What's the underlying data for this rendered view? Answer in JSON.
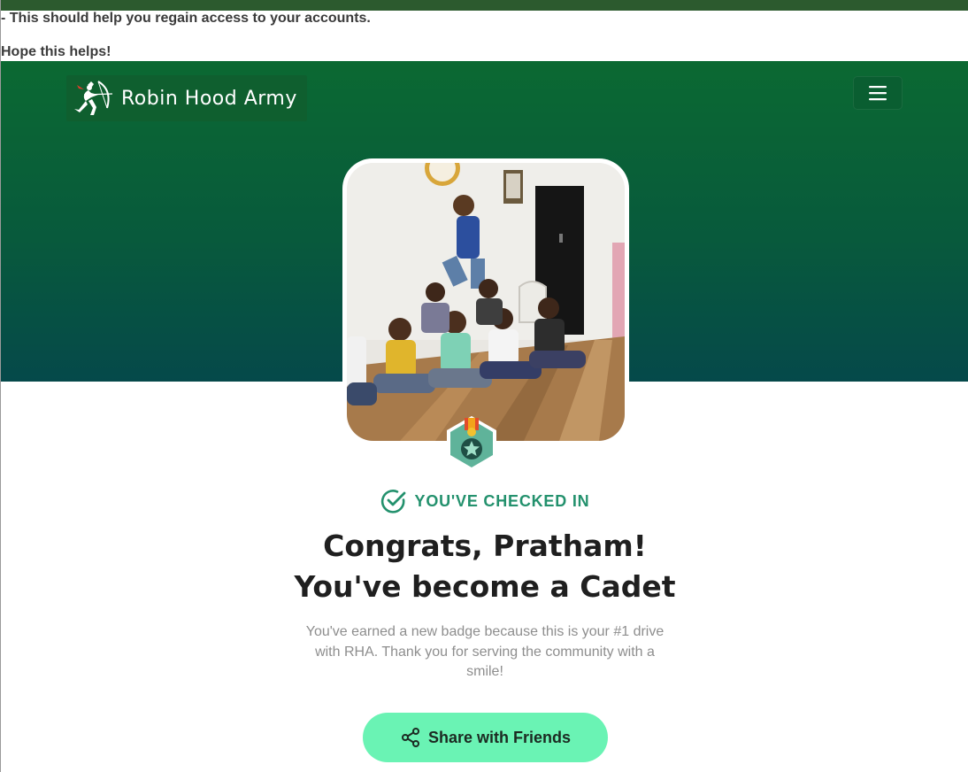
{
  "prelude": {
    "line1": "- This should help you regain access to your accounts.",
    "line2": "Hope this helps!"
  },
  "header": {
    "brand_name": "Robin Hood Army",
    "logo_icon": "archer-logo-icon",
    "menu_icon": "hamburger-menu-icon"
  },
  "hero": {
    "photo": "group-of-children-sitting-on-floor-photo",
    "badge_icon": "medal-star-badge-icon"
  },
  "checkin": {
    "status_text": "YOU'VE CHECKED IN",
    "status_icon": "check-circle-icon"
  },
  "headline": {
    "line1": "Congrats, Pratham!",
    "line2": "You've become a Cadet"
  },
  "message": "You've earned a new badge because this is your #1 drive with RHA. Thank you for serving the community with a smile!",
  "share": {
    "label": "Share with Friends",
    "icon": "share-icon"
  },
  "colors": {
    "hero_top": "#0b6932",
    "hero_bottom": "#05494a",
    "accent_green": "#23916d",
    "button_bg": "#6af3b4",
    "headline_text": "#1f1f1f",
    "muted_text": "#8e8e8e"
  }
}
